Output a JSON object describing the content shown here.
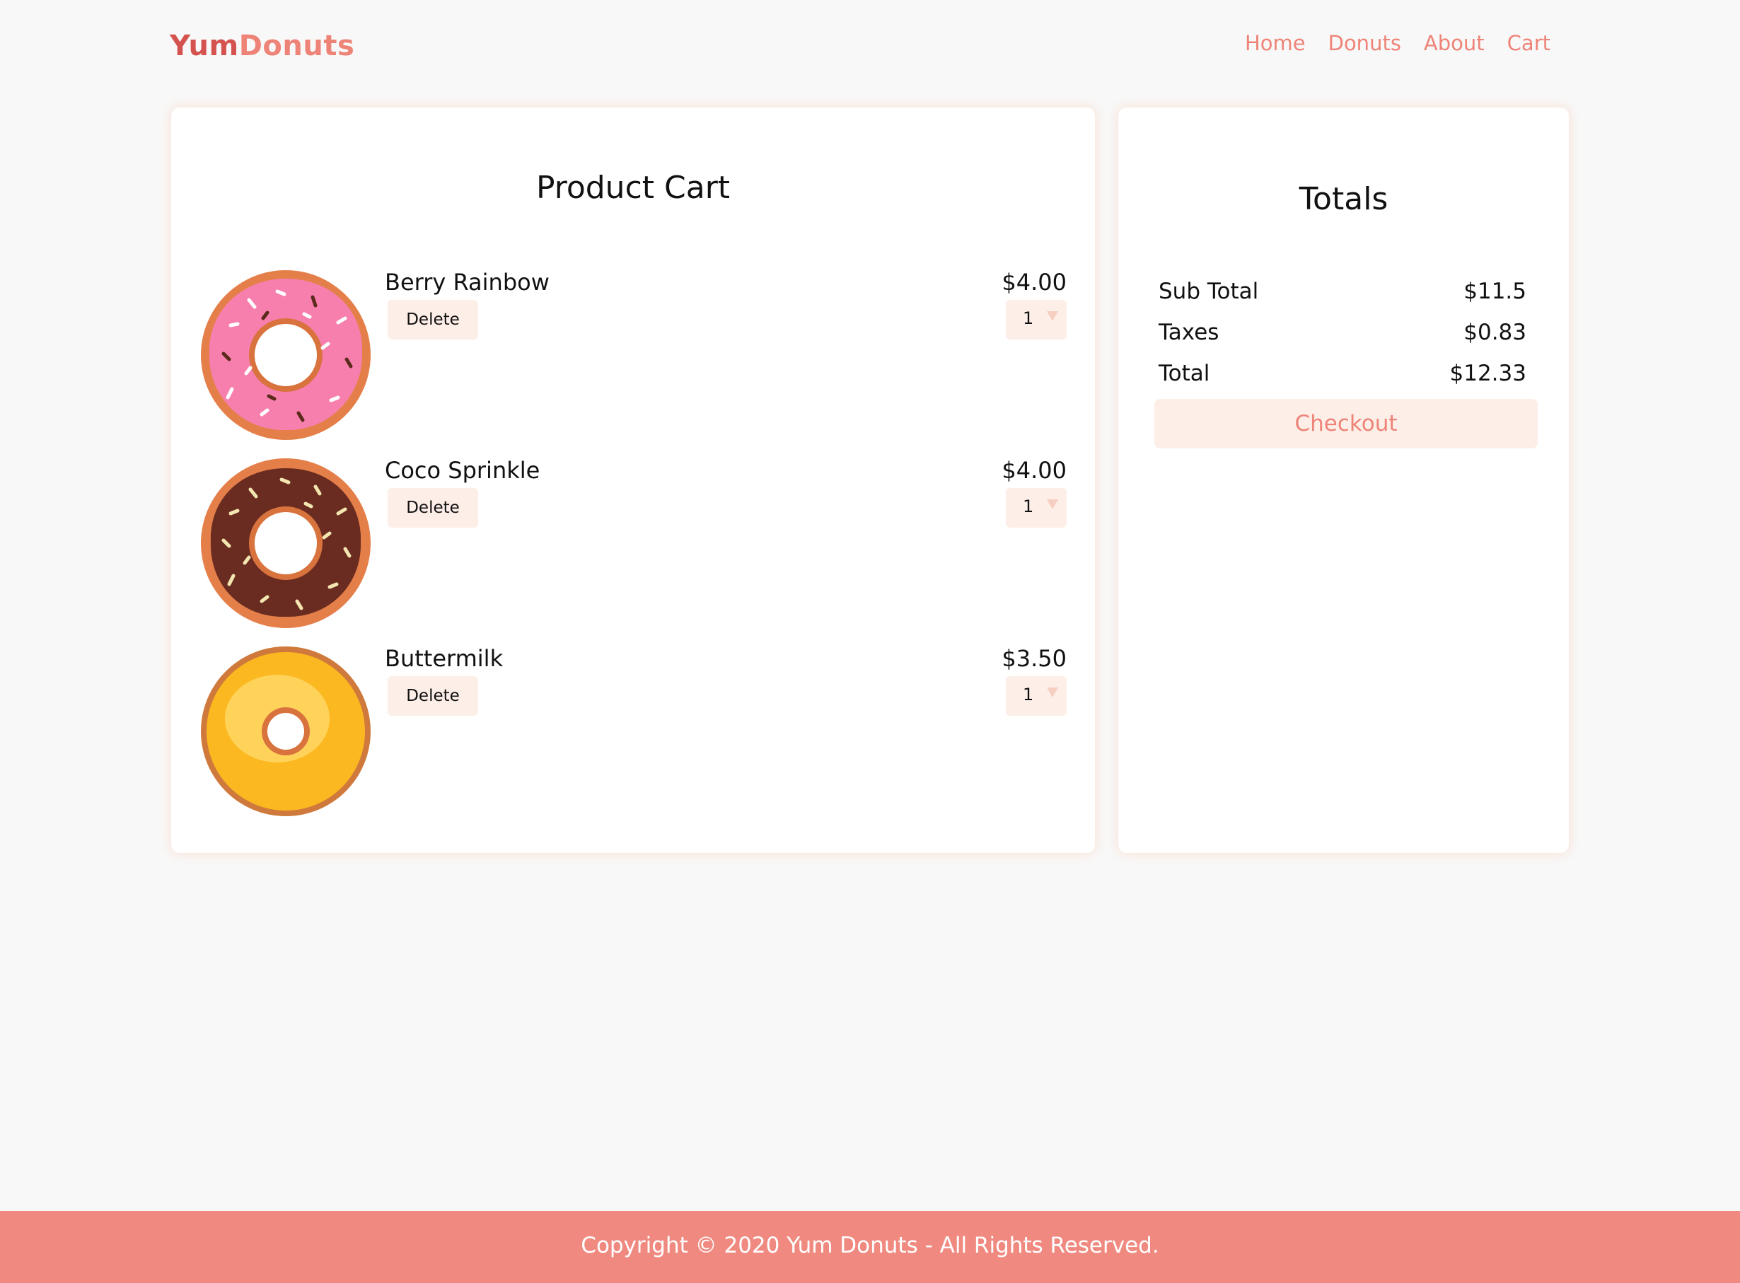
{
  "brand": {
    "part1": "Yum",
    "part2": "Donuts"
  },
  "nav": [
    {
      "label": "Home"
    },
    {
      "label": "Donuts"
    },
    {
      "label": "About"
    },
    {
      "label": "Cart"
    }
  ],
  "cart": {
    "title": "Product Cart",
    "delete_label": "Delete",
    "items": [
      {
        "name": "Berry Rainbow",
        "price": "$4.00",
        "qty": "1",
        "image": "pink-frosted-donut-with-sprinkles"
      },
      {
        "name": "Coco Sprinkle",
        "price": "$4.00",
        "qty": "1",
        "image": "chocolate-frosted-donut-with-sprinkles"
      },
      {
        "name": "Buttermilk",
        "price": "$3.50",
        "qty": "1",
        "image": "glazed-yellow-donut"
      }
    ]
  },
  "totals": {
    "title": "Totals",
    "rows": [
      {
        "label": "Sub Total",
        "value": "$11.5"
      },
      {
        "label": "Taxes",
        "value": "$0.83"
      },
      {
        "label": "Total",
        "value": "$12.33"
      }
    ],
    "checkout_label": "Checkout"
  },
  "footer": {
    "text": "Copyright © 2020 Yum Donuts - All Rights Reserved."
  },
  "colors": {
    "accent": "#ee8478",
    "logo_dark": "#d4534f",
    "button_bg": "#fdeee8",
    "footer_bg": "#f08a80",
    "page_bg": "#f8f8f8"
  }
}
